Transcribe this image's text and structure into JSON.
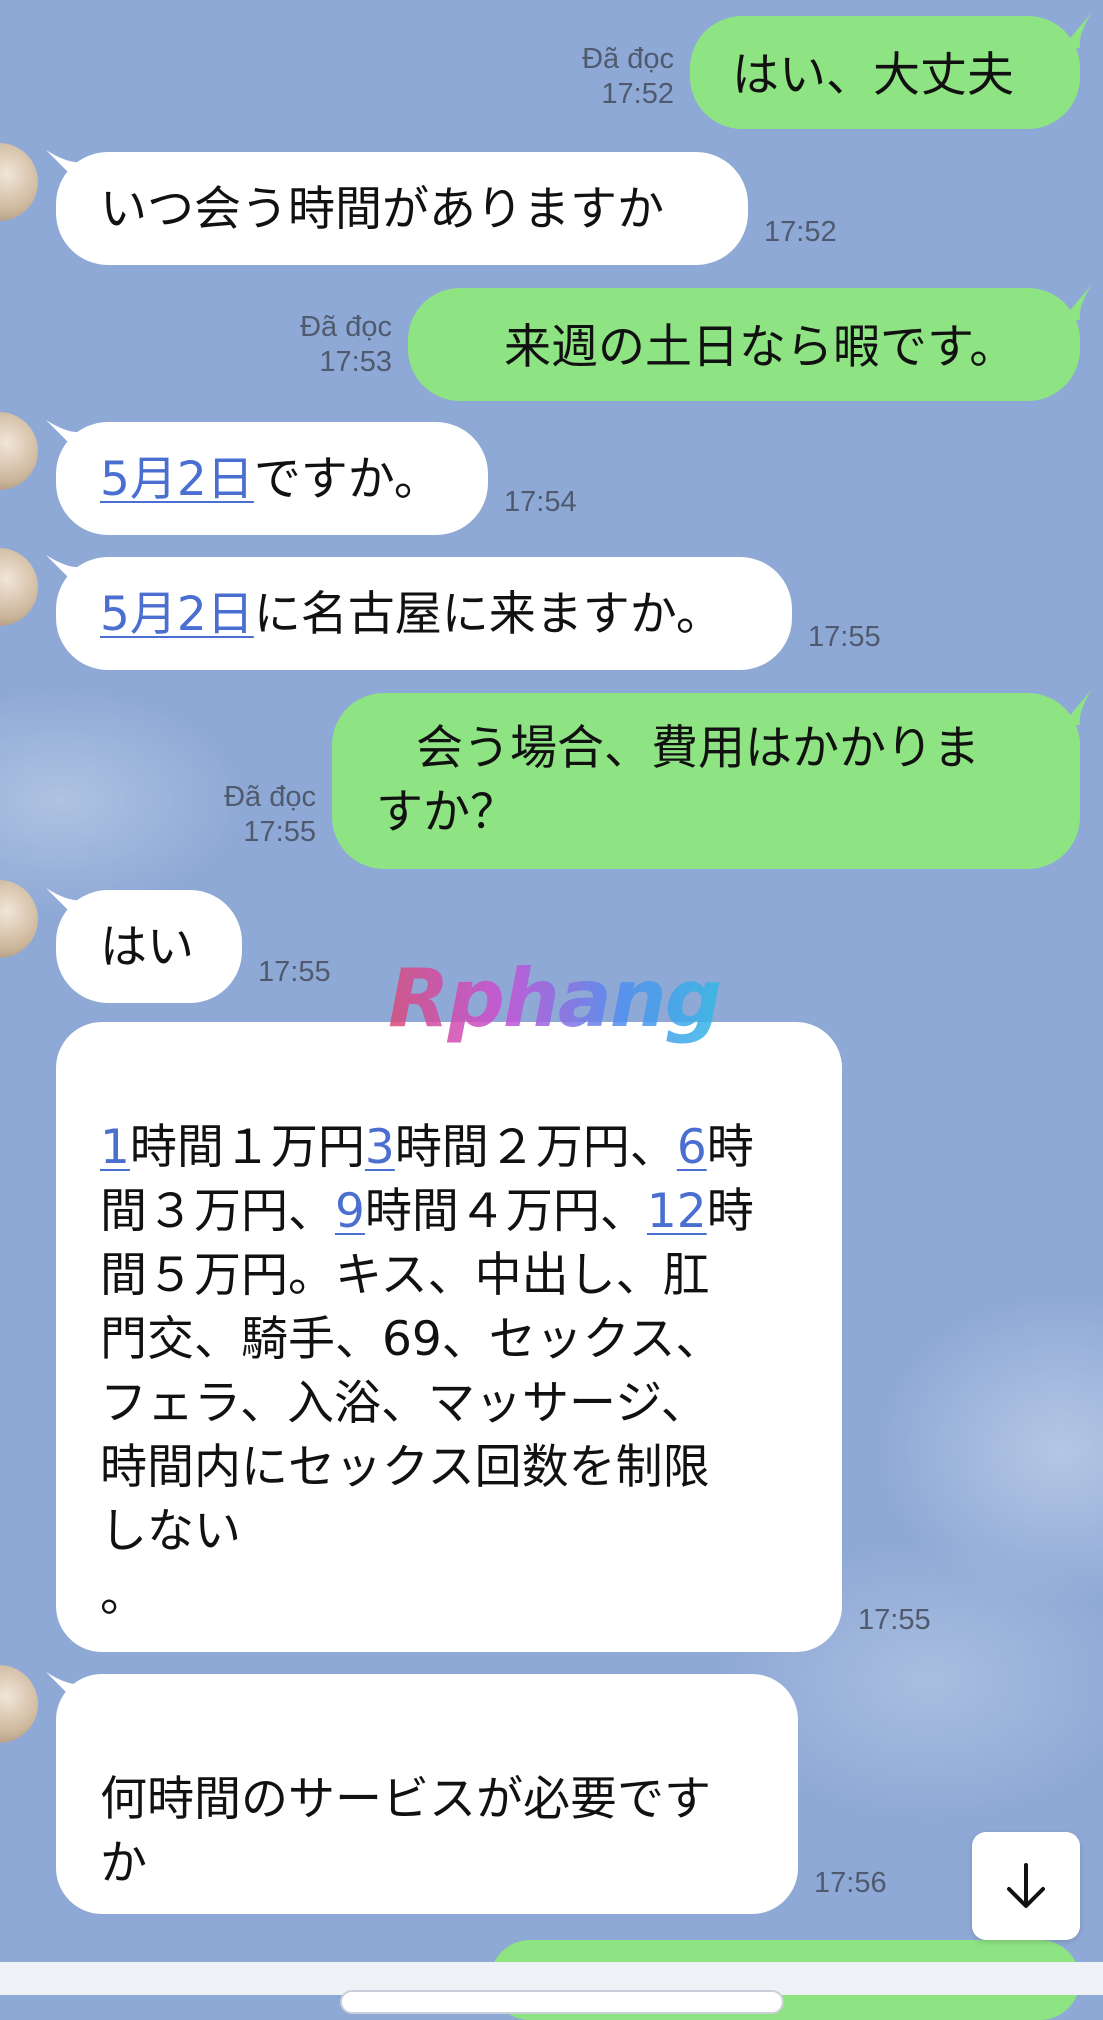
{
  "messages": [
    {
      "dir": "out",
      "text": "はい、大丈夫",
      "status": "Đã đọc",
      "time": "17:52"
    },
    {
      "dir": "in",
      "text": "いつ会う時間がありますか",
      "time": "17:52"
    },
    {
      "dir": "out",
      "text": "来週の土日なら暇です。",
      "status": "Đã đọc",
      "time": "17:53"
    },
    {
      "dir": "in",
      "link": "5月2日",
      "text": "ですか。",
      "time": "17:54"
    },
    {
      "dir": "in",
      "link": "5月2日",
      "text": "に名古屋に来ますか。",
      "time": "17:55"
    },
    {
      "dir": "out",
      "line1": "会う場合、費用はかかりま",
      "line2": "すか？",
      "status": "Đã đọc",
      "time": "17:55"
    },
    {
      "dir": "in",
      "text": "はい",
      "time": "17:55"
    },
    {
      "dir": "in",
      "line1": {
        "l1": "1",
        "t1": "時間１万円",
        "l2": "3",
        "t2": "時間２万円、",
        "l3": "6",
        "t3": "時"
      },
      "line2": {
        "t0": "間３万円、",
        "l1": "9",
        "t1": "時間４万円、",
        "l2": "12",
        "t2": "時"
      },
      "line3": "間５万円。キス、中出し、肛",
      "line4": "門交、騎手、69、セックス、",
      "line5": "フェラ、入浴、マッサージ、",
      "line6": "時間内にセックス回数を制限",
      "line7": "しない",
      "line8": "。",
      "time": "17:55"
    },
    {
      "dir": "in",
      "line1": "何時間のサービスが必要です",
      "line2": "か",
      "time": "17:56"
    }
  ],
  "watermark": "Rphang",
  "scroll_button": {
    "icon": "arrow-down-icon"
  },
  "colors": {
    "background": "#8fa9d6",
    "outgoing": "#8ee383",
    "incoming": "#ffffff",
    "link": "#4a6fd0"
  }
}
